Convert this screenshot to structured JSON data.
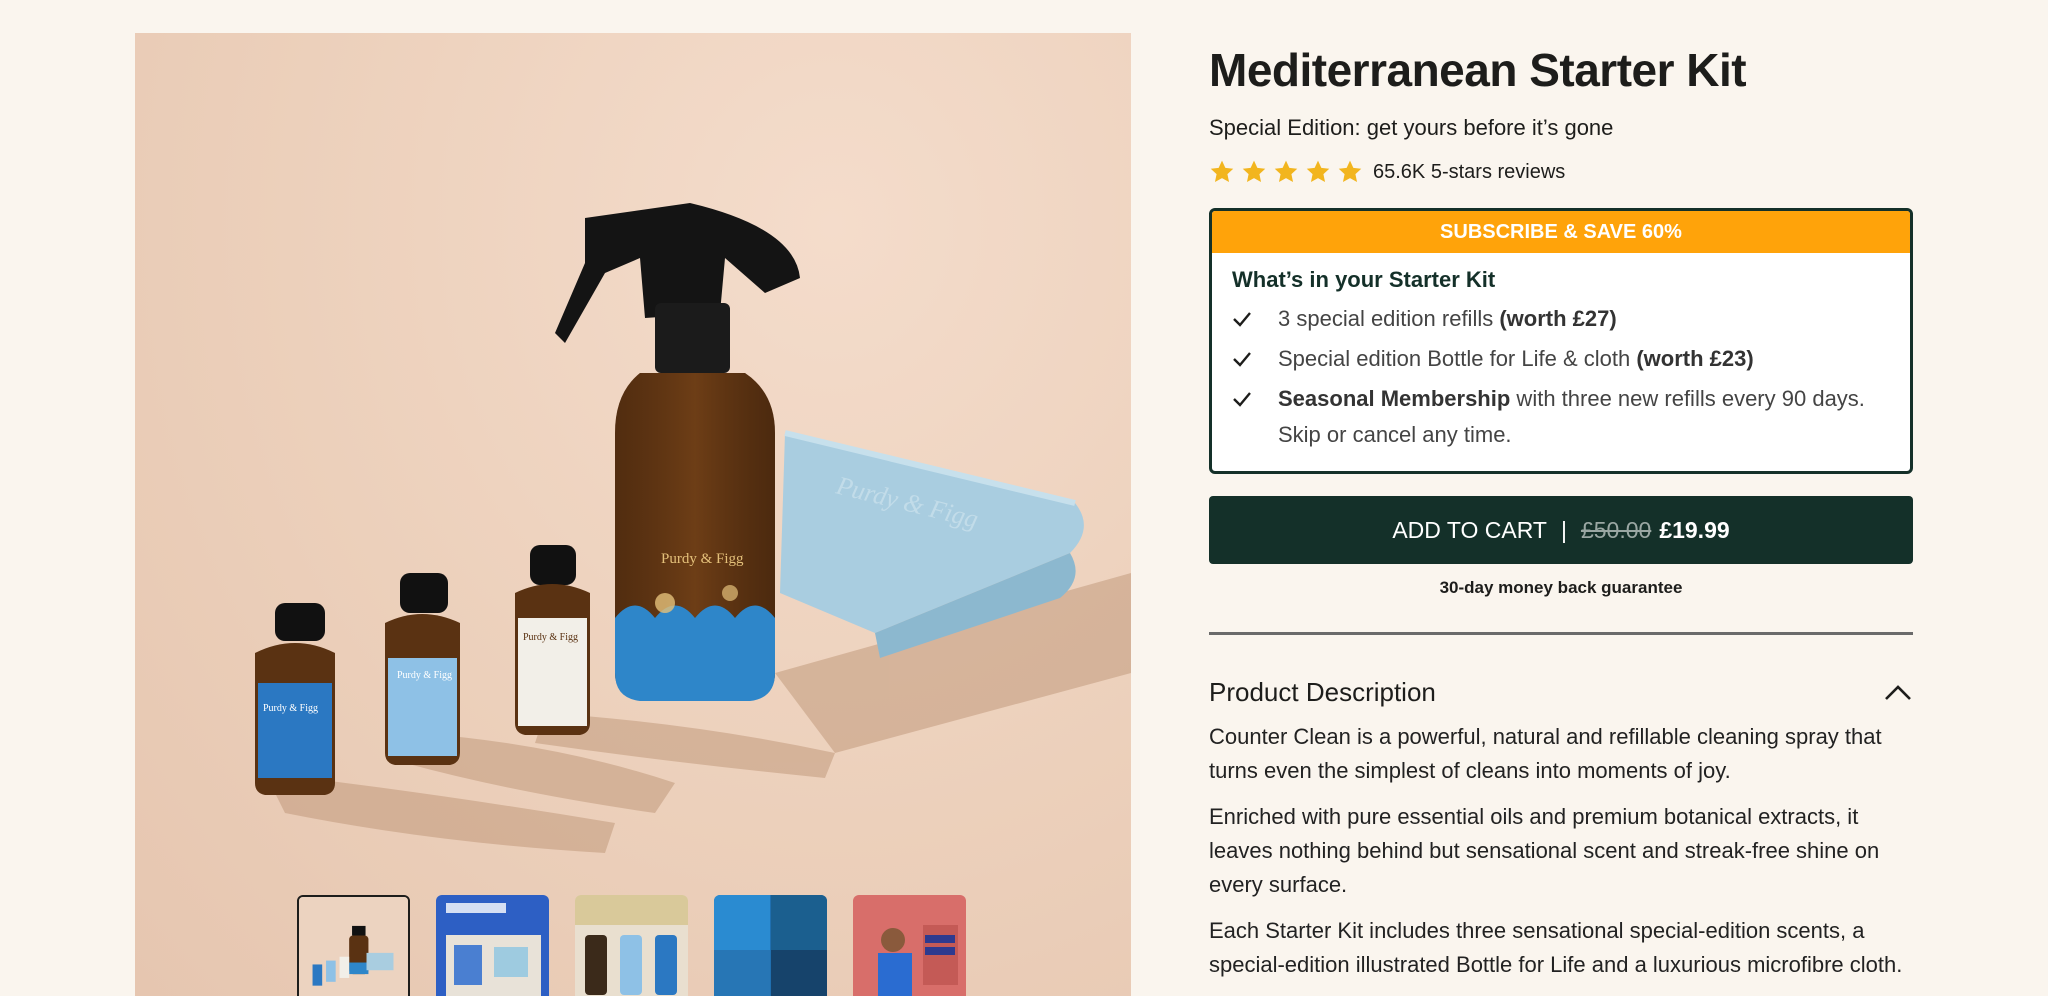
{
  "product": {
    "title": "Mediterranean Starter Kit",
    "subtitle": "Special Edition: get yours before it’s gone",
    "rating": {
      "stars": 5,
      "text": "65.6K 5-stars reviews",
      "star_color": "#f2b51e"
    }
  },
  "gallery": {
    "bottle_label": "Purdy & Figg",
    "thumbnails": [
      {
        "name": "starter-kit"
      },
      {
        "name": "gift-box"
      },
      {
        "name": "three-bottles"
      },
      {
        "name": "cleaning-collage"
      },
      {
        "name": "man-cleaning"
      }
    ]
  },
  "offer": {
    "banner": "SUBSCRIBE & SAVE 60%",
    "banner_color": "#ffa30a",
    "heading": "What’s in your Starter Kit",
    "items": [
      {
        "text": "3 special edition refills ",
        "bold": "(worth £27)"
      },
      {
        "text": "Special edition Bottle for Life & cloth ",
        "bold": "(worth £23)"
      },
      {
        "bold_lead": "Seasonal Membership",
        "text": " with three new refills every 90 days. Skip or cancel any time."
      }
    ]
  },
  "cart": {
    "label": "ADD TO CART",
    "separator": "|",
    "old_price": "£50.00",
    "new_price": "£19.99",
    "guarantee": "30-day money back guarantee",
    "color": "#143029"
  },
  "description": {
    "title": "Product Description",
    "paragraphs": [
      "Counter Clean is a powerful, natural and refillable cleaning spray that turns even the simplest of cleans into moments of joy.",
      "Enriched with pure essential oils and premium botanical extracts, it leaves nothing behind but sensational scent and streak-free shine on every surface.",
      "Each Starter Kit includes three sensational special-edition scents, a special-edition illustrated Bottle for Life and a luxurious microfibre cloth."
    ]
  }
}
